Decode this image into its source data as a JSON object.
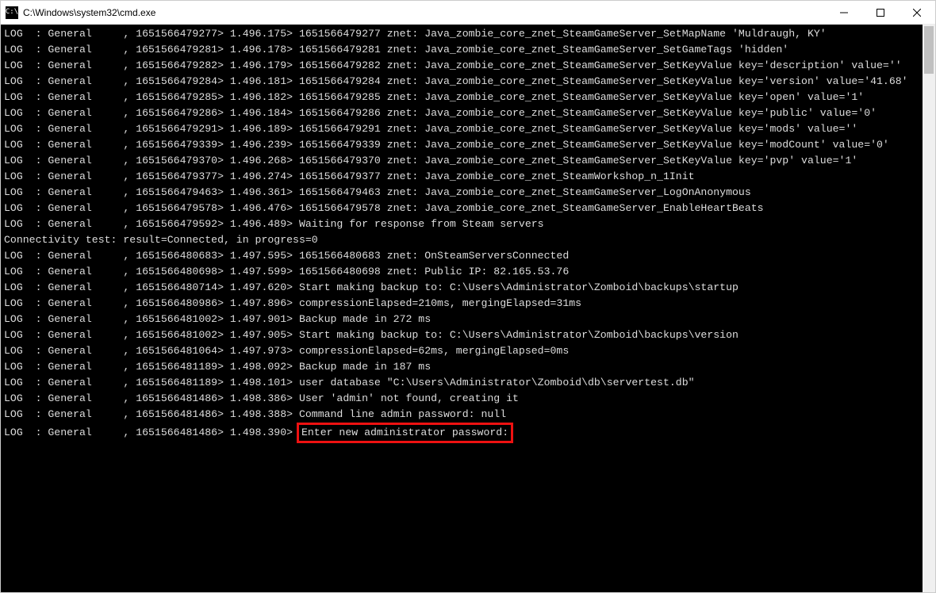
{
  "window": {
    "title": "C:\\Windows\\system32\\cmd.exe",
    "icon_label": "C:\\"
  },
  "log": {
    "prefix": "LOG  : General",
    "conn_test": "Connectivity test: result=Connected, in progress=0",
    "lines": [
      {
        "ts1": "1651566479277",
        "t": "1.496.175",
        "ts2": "1651566479277",
        "msg": "znet: Java_zombie_core_znet_SteamGameServer_SetMapName 'Muldraugh, KY'"
      },
      {
        "ts1": "1651566479281",
        "t": "1.496.178",
        "ts2": "1651566479281",
        "msg": "znet: Java_zombie_core_znet_SteamGameServer_SetGameTags 'hidden'"
      },
      {
        "ts1": "1651566479282",
        "t": "1.496.179",
        "ts2": "1651566479282",
        "msg": "znet: Java_zombie_core_znet_SteamGameServer_SetKeyValue key='description' value=''"
      },
      {
        "ts1": "1651566479284",
        "t": "1.496.181",
        "ts2": "1651566479284",
        "msg": "znet: Java_zombie_core_znet_SteamGameServer_SetKeyValue key='version' value='41.68'"
      },
      {
        "ts1": "1651566479285",
        "t": "1.496.182",
        "ts2": "1651566479285",
        "msg": "znet: Java_zombie_core_znet_SteamGameServer_SetKeyValue key='open' value='1'"
      },
      {
        "ts1": "1651566479286",
        "t": "1.496.184",
        "ts2": "1651566479286",
        "msg": "znet: Java_zombie_core_znet_SteamGameServer_SetKeyValue key='public' value='0'"
      },
      {
        "ts1": "1651566479291",
        "t": "1.496.189",
        "ts2": "1651566479291",
        "msg": "znet: Java_zombie_core_znet_SteamGameServer_SetKeyValue key='mods' value=''"
      },
      {
        "ts1": "1651566479339",
        "t": "1.496.239",
        "ts2": "1651566479339",
        "msg": "znet: Java_zombie_core_znet_SteamGameServer_SetKeyValue key='modCount' value='0'"
      },
      {
        "ts1": "1651566479370",
        "t": "1.496.268",
        "ts2": "1651566479370",
        "msg": "znet: Java_zombie_core_znet_SteamGameServer_SetKeyValue key='pvp' value='1'"
      },
      {
        "ts1": "1651566479377",
        "t": "1.496.274",
        "ts2": "1651566479377",
        "msg": "znet: Java_zombie_core_znet_SteamWorkshop_n_1Init"
      },
      {
        "ts1": "1651566479463",
        "t": "1.496.361",
        "ts2": "1651566479463",
        "msg": "znet: Java_zombie_core_znet_SteamGameServer_LogOnAnonymous"
      },
      {
        "ts1": "1651566479578",
        "t": "1.496.476",
        "ts2": "1651566479578",
        "msg": "znet: Java_zombie_core_znet_SteamGameServer_EnableHeartBeats"
      },
      {
        "ts1": "1651566479592",
        "t": "1.496.489",
        "ts2": "",
        "msg": "Waiting for response from Steam servers"
      },
      {
        "raw": "CONN_TEST"
      },
      {
        "ts1": "1651566480683",
        "t": "1.497.595",
        "ts2": "1651566480683",
        "msg": "znet: OnSteamServersConnected"
      },
      {
        "ts1": "1651566480698",
        "t": "1.497.599",
        "ts2": "1651566480698",
        "msg": "znet: Public IP: 82.165.53.76"
      },
      {
        "ts1": "1651566480714",
        "t": "1.497.620",
        "ts2": "",
        "msg": "Start making backup to: C:\\Users\\Administrator\\Zomboid\\backups\\startup"
      },
      {
        "ts1": "1651566480986",
        "t": "1.497.896",
        "ts2": "",
        "msg": "compressionElapsed=210ms, mergingElapsed=31ms"
      },
      {
        "ts1": "1651566481002",
        "t": "1.497.901",
        "ts2": "",
        "msg": "Backup made in 272 ms"
      },
      {
        "ts1": "1651566481002",
        "t": "1.497.905",
        "ts2": "",
        "msg": "Start making backup to: C:\\Users\\Administrator\\Zomboid\\backups\\version"
      },
      {
        "ts1": "1651566481064",
        "t": "1.497.973",
        "ts2": "",
        "msg": "compressionElapsed=62ms, mergingElapsed=0ms"
      },
      {
        "ts1": "1651566481189",
        "t": "1.498.092",
        "ts2": "",
        "msg": "Backup made in 187 ms"
      },
      {
        "ts1": "1651566481189",
        "t": "1.498.101",
        "ts2": "",
        "msg": "user database \"C:\\Users\\Administrator\\Zomboid\\db\\servertest.db\""
      },
      {
        "ts1": "1651566481486",
        "t": "1.498.386",
        "ts2": "",
        "msg": "User 'admin' not found, creating it"
      },
      {
        "ts1": "1651566481486",
        "t": "1.498.388",
        "ts2": "",
        "msg": "Command line admin password: null"
      },
      {
        "ts1": "1651566481486",
        "t": "1.498.390",
        "ts2": "",
        "msg": "Enter new administrator password:",
        "highlight": true
      }
    ]
  }
}
